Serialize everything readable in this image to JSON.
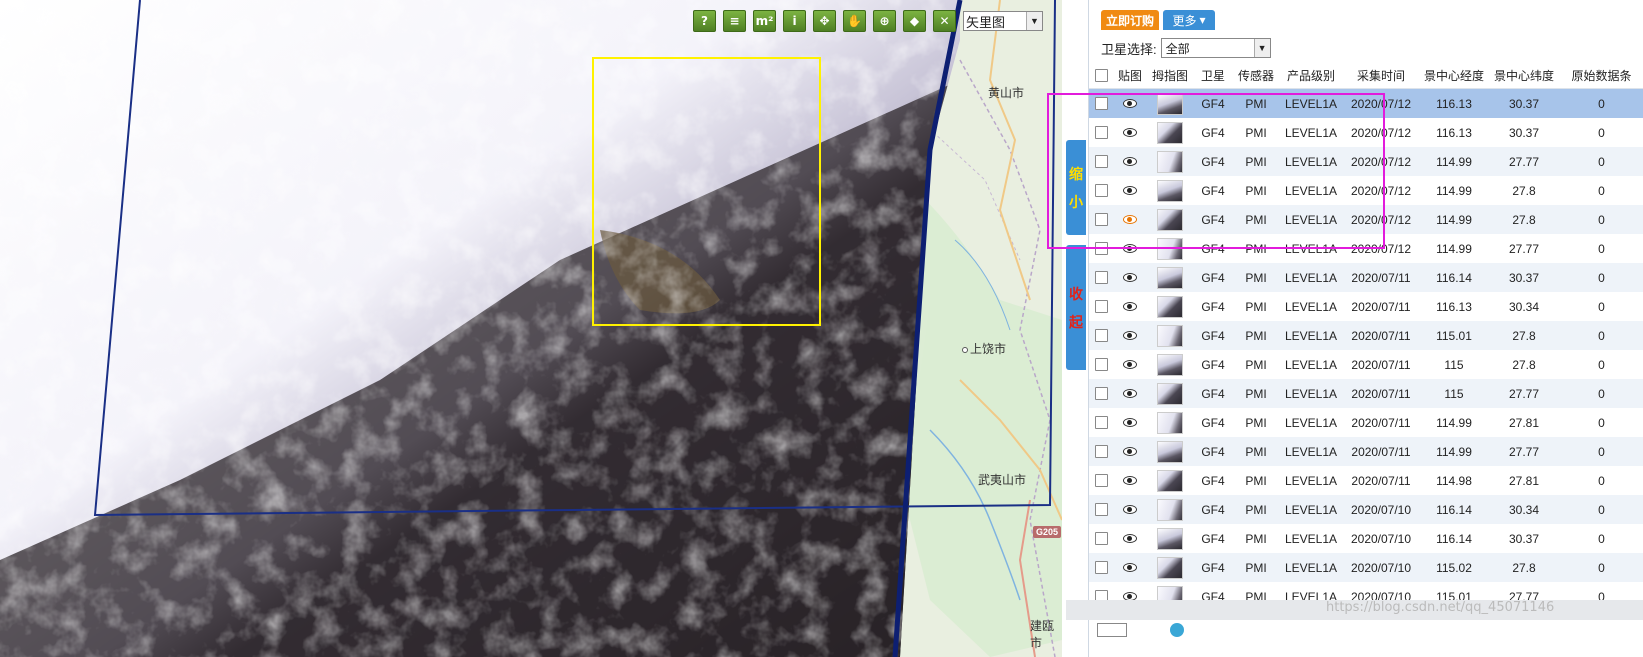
{
  "map": {
    "toolbar": [
      {
        "name": "help-tool-button",
        "glyph": "?"
      },
      {
        "name": "layer-list-tool-button",
        "glyph": "≡"
      },
      {
        "name": "measure-area-tool-button",
        "glyph": "m²"
      },
      {
        "name": "info-tool-button",
        "glyph": "i"
      },
      {
        "name": "full-extent-tool-button",
        "glyph": "✥"
      },
      {
        "name": "pan-hand-tool-button",
        "glyph": "✋"
      },
      {
        "name": "locate-tool-button",
        "glyph": "⊕"
      },
      {
        "name": "draw-polygon-tool-button",
        "glyph": "◆"
      },
      {
        "name": "clear-tool-button",
        "glyph": "✕"
      }
    ],
    "map_type": {
      "value": "矢里图"
    },
    "places": {
      "huangshan": "黄山市",
      "shangrao": "上饶市",
      "wuyishan": "武夷山市",
      "jianou": "建瓯市"
    },
    "road_shield": "G205",
    "side_tabs": {
      "shrink": [
        "缩",
        "小"
      ],
      "collapse": [
        "收",
        "起"
      ]
    },
    "colors": {
      "footprint": "#1a2f86",
      "aoi": "#fff200",
      "selection": "#e21bdc"
    }
  },
  "panel": {
    "order_button": "立即订购",
    "more_button": "更多",
    "satellite_label": "卫星选择:",
    "satellite_value": "全部",
    "columns": [
      "贴图",
      "拇指图",
      "卫星",
      "传感器",
      "产品级别",
      "采集时间",
      "景中心经度",
      "景中心纬度",
      "原始数据条"
    ],
    "rows": [
      {
        "sat": "GF4",
        "sensor": "PMI",
        "level": "LEVEL1A",
        "time": "2020/07/12",
        "lon": "116.13",
        "lat": "30.37",
        "raw": "0",
        "selected": true,
        "active_eye": false
      },
      {
        "sat": "GF4",
        "sensor": "PMI",
        "level": "LEVEL1A",
        "time": "2020/07/12",
        "lon": "116.13",
        "lat": "30.37",
        "raw": "0",
        "selected": false,
        "active_eye": false
      },
      {
        "sat": "GF4",
        "sensor": "PMI",
        "level": "LEVEL1A",
        "time": "2020/07/12",
        "lon": "114.99",
        "lat": "27.77",
        "raw": "0",
        "selected": false,
        "active_eye": false
      },
      {
        "sat": "GF4",
        "sensor": "PMI",
        "level": "LEVEL1A",
        "time": "2020/07/12",
        "lon": "114.99",
        "lat": "27.8",
        "raw": "0",
        "selected": false,
        "active_eye": false
      },
      {
        "sat": "GF4",
        "sensor": "PMI",
        "level": "LEVEL1A",
        "time": "2020/07/12",
        "lon": "114.99",
        "lat": "27.8",
        "raw": "0",
        "selected": false,
        "active_eye": true
      },
      {
        "sat": "GF4",
        "sensor": "PMI",
        "level": "LEVEL1A",
        "time": "2020/07/12",
        "lon": "114.99",
        "lat": "27.77",
        "raw": "0",
        "selected": false,
        "active_eye": false
      },
      {
        "sat": "GF4",
        "sensor": "PMI",
        "level": "LEVEL1A",
        "time": "2020/07/11",
        "lon": "116.14",
        "lat": "30.37",
        "raw": "0",
        "selected": false,
        "active_eye": false
      },
      {
        "sat": "GF4",
        "sensor": "PMI",
        "level": "LEVEL1A",
        "time": "2020/07/11",
        "lon": "116.13",
        "lat": "30.34",
        "raw": "0",
        "selected": false,
        "active_eye": false
      },
      {
        "sat": "GF4",
        "sensor": "PMI",
        "level": "LEVEL1A",
        "time": "2020/07/11",
        "lon": "115.01",
        "lat": "27.8",
        "raw": "0",
        "selected": false,
        "active_eye": false
      },
      {
        "sat": "GF4",
        "sensor": "PMI",
        "level": "LEVEL1A",
        "time": "2020/07/11",
        "lon": "115",
        "lat": "27.8",
        "raw": "0",
        "selected": false,
        "active_eye": false
      },
      {
        "sat": "GF4",
        "sensor": "PMI",
        "level": "LEVEL1A",
        "time": "2020/07/11",
        "lon": "115",
        "lat": "27.77",
        "raw": "0",
        "selected": false,
        "active_eye": false
      },
      {
        "sat": "GF4",
        "sensor": "PMI",
        "level": "LEVEL1A",
        "time": "2020/07/11",
        "lon": "114.99",
        "lat": "27.81",
        "raw": "0",
        "selected": false,
        "active_eye": false
      },
      {
        "sat": "GF4",
        "sensor": "PMI",
        "level": "LEVEL1A",
        "time": "2020/07/11",
        "lon": "114.99",
        "lat": "27.77",
        "raw": "0",
        "selected": false,
        "active_eye": false
      },
      {
        "sat": "GF4",
        "sensor": "PMI",
        "level": "LEVEL1A",
        "time": "2020/07/11",
        "lon": "114.98",
        "lat": "27.81",
        "raw": "0",
        "selected": false,
        "active_eye": false
      },
      {
        "sat": "GF4",
        "sensor": "PMI",
        "level": "LEVEL1A",
        "time": "2020/07/10",
        "lon": "116.14",
        "lat": "30.34",
        "raw": "0",
        "selected": false,
        "active_eye": false
      },
      {
        "sat": "GF4",
        "sensor": "PMI",
        "level": "LEVEL1A",
        "time": "2020/07/10",
        "lon": "116.14",
        "lat": "30.37",
        "raw": "0",
        "selected": false,
        "active_eye": false
      },
      {
        "sat": "GF4",
        "sensor": "PMI",
        "level": "LEVEL1A",
        "time": "2020/07/10",
        "lon": "115.02",
        "lat": "27.8",
        "raw": "0",
        "selected": false,
        "active_eye": false
      },
      {
        "sat": "GF4",
        "sensor": "PMI",
        "level": "LEVEL1A",
        "time": "2020/07/10",
        "lon": "115.01",
        "lat": "27.77",
        "raw": "0",
        "selected": false,
        "active_eye": false
      }
    ]
  },
  "watermark": "https://blog.csdn.net/qq_45071146"
}
